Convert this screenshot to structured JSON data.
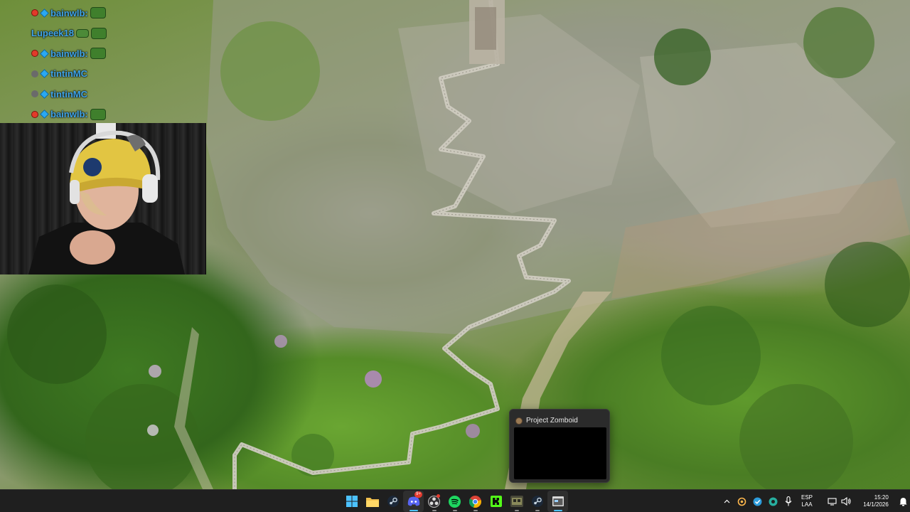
{
  "chat": {
    "messages": [
      {
        "user": "bainwlb:",
        "badges": [
          "red",
          "blue"
        ],
        "emote": "pepe"
      },
      {
        "user": "Lupeek18",
        "badges": [],
        "emote": "pepe-small"
      },
      {
        "user": "bainwlb:",
        "badges": [
          "red",
          "blue"
        ],
        "emote": "pepe"
      },
      {
        "user": "tintinMC",
        "badges": [
          "gray",
          "blue"
        ],
        "emote": "none"
      },
      {
        "user": "tintinMC",
        "badges": [
          "gray",
          "blue"
        ],
        "emote": "none"
      },
      {
        "user": "bainwlb:",
        "badges": [
          "red",
          "blue"
        ],
        "emote": "pepe"
      }
    ]
  },
  "webcam": {
    "label": "streamer-webcam"
  },
  "preview": {
    "title": "Project Zomboid"
  },
  "taskbar": {
    "apps": [
      {
        "name": "start",
        "icon": "windows-logo-icon"
      },
      {
        "name": "file-explorer",
        "icon": "folder-icon"
      },
      {
        "name": "steam-pinned",
        "icon": "steam-icon"
      },
      {
        "name": "discord",
        "icon": "discord-icon",
        "badge": "9+"
      },
      {
        "name": "obs",
        "icon": "obs-icon"
      },
      {
        "name": "spotify",
        "icon": "spotify-icon"
      },
      {
        "name": "chrome",
        "icon": "chrome-icon"
      },
      {
        "name": "kick",
        "icon": "kick-icon"
      },
      {
        "name": "project-zomboid",
        "icon": "zomboid-icon"
      },
      {
        "name": "steam",
        "icon": "steam-icon"
      },
      {
        "name": "generic-window",
        "icon": "window-icon"
      }
    ],
    "tray": {
      "language_top": "ESP",
      "language_bottom": "LAA",
      "time": "15:20",
      "date": "14/1/2026"
    }
  },
  "colors": {
    "taskbar_bg": "#1f1f1f",
    "chat_name": "#3fa3e6",
    "active_indicator": "#4cc2ff"
  }
}
